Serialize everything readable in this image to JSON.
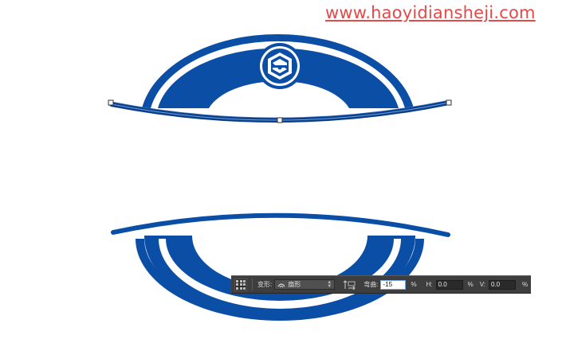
{
  "watermark": "www.haoyidiansheji.com",
  "colors": {
    "logo_blue": "#0a4ea6",
    "logo_blue_dark": "#083f8a",
    "watermark_red": "#e24a4a",
    "toolbar_bg": "#3e3e3e"
  },
  "toolbar": {
    "warp_label": "变形:",
    "warp_style": "扇形",
    "warp_style_icon": "arc-warp-icon",
    "orientation_icon": "warp-orientation-icon",
    "bend_label": "弯曲:",
    "bend_value": "-15",
    "bend_unit": "%",
    "h_label": "H:",
    "h_value": "0.0",
    "h_unit": "%",
    "v_label": "V:",
    "v_value": "0.0",
    "v_unit": "%"
  }
}
